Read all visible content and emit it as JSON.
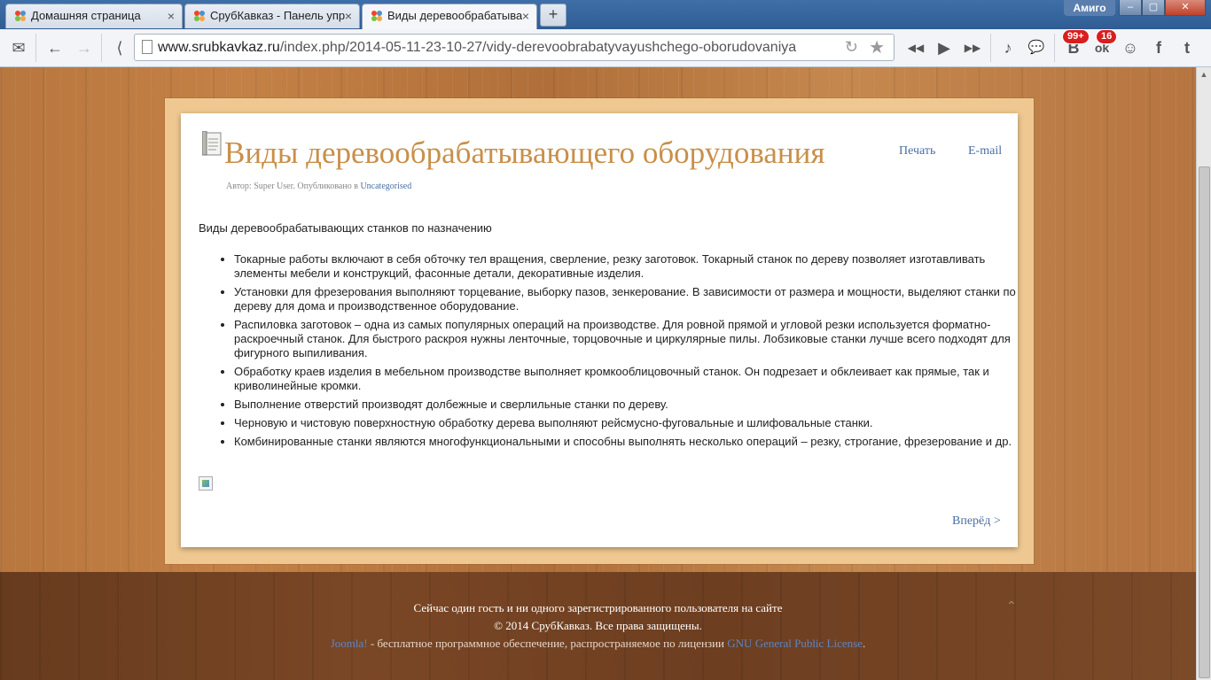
{
  "browser": {
    "tabs": [
      {
        "label": "Домашняя страница",
        "active": false
      },
      {
        "label": "СрубКавказ - Панель упра",
        "active": false
      },
      {
        "label": "Виды деревообрабатываю",
        "active": true
      }
    ],
    "new_tab_label": "+",
    "profile_name": "Амиго",
    "window_buttons": {
      "minimize": "–",
      "maximize": "▢",
      "close": "✕"
    },
    "url_host": "www.srubkavkaz.ru",
    "url_path": "/index.php/2014-05-11-23-10-27/vidy-derevoobrabatyvayushchego-oborudovaniya",
    "badges": {
      "vk": "99+",
      "ok": "16"
    },
    "icons": {
      "mail": "✉",
      "back": "←",
      "forward": "→",
      "share": "⟨",
      "reload": "↻",
      "star": "★",
      "prev": "◀◀",
      "play": "▶",
      "next": "▶▶",
      "music": "♪",
      "chat": "💬",
      "vk": "В",
      "ok": "ok",
      "friends": "☺",
      "facebook": "f",
      "twitter": "t"
    }
  },
  "article": {
    "title": "Виды деревообрабатывающего оборудования",
    "print_label": "Печать",
    "email_label": "E-mail",
    "byline_prefix": "Автор: Super User. Опубликовано в ",
    "byline_category": "Uncategorised",
    "intro": "Виды деревообрабатывающих станков по назначению",
    "bullets": [
      "Токарные работы включают в себя обточку тел вращения, сверление, резку заготовок. Токарный станок по дереву позволяет изготавливать элементы мебели и конструкций, фасонные детали, декоративные изделия.",
      "Установки для фрезерования выполняют торцевание, выборку пазов, зенкерование. В зависимости от размера и мощности, выделяют станки по дереву для дома и производственное оборудование.",
      "Распиловка заготовок – одна из самых популярных операций на производстве. Для ровной прямой и угловой резки используется форматно-раскроечный станок. Для быстрого раскроя нужны ленточные, торцовочные и циркулярные пилы. Лобзиковые станки лучше всего подходят для фигурного выпиливания.",
      "Обработку краев изделия в мебельном производстве выполняет кромкооблицовочный станок. Он подрезает и обклеивает как прямые, так и криволинейные кромки.",
      "Выполнение отверстий производят долбежные и сверлильные станки по дереву.",
      "Черновую и чистовую поверхностную обработку дерева выполняют рейсмусно-фуговальные и шлифовальные станки.",
      "Комбинированные станки являются многофункциональными и способны выполнять несколько операций – резку, строгание, фрезерование и др."
    ],
    "next_label": "Вперёд >"
  },
  "footer": {
    "online": "Сейчас один гость и ни одного зарегистрированного пользователя на сайте",
    "copyright": "© 2014 СрубКавказ. Все права защищены.",
    "joomla": "Joomla!",
    "license_text": " - бесплатное программное обеспечение, распространяемое по лицензии ",
    "license_link": "GNU General Public License",
    "license_end": "."
  },
  "colors": {
    "title": "#c98f4a",
    "link": "#4a6fa3",
    "badge": "#d81e1e"
  }
}
